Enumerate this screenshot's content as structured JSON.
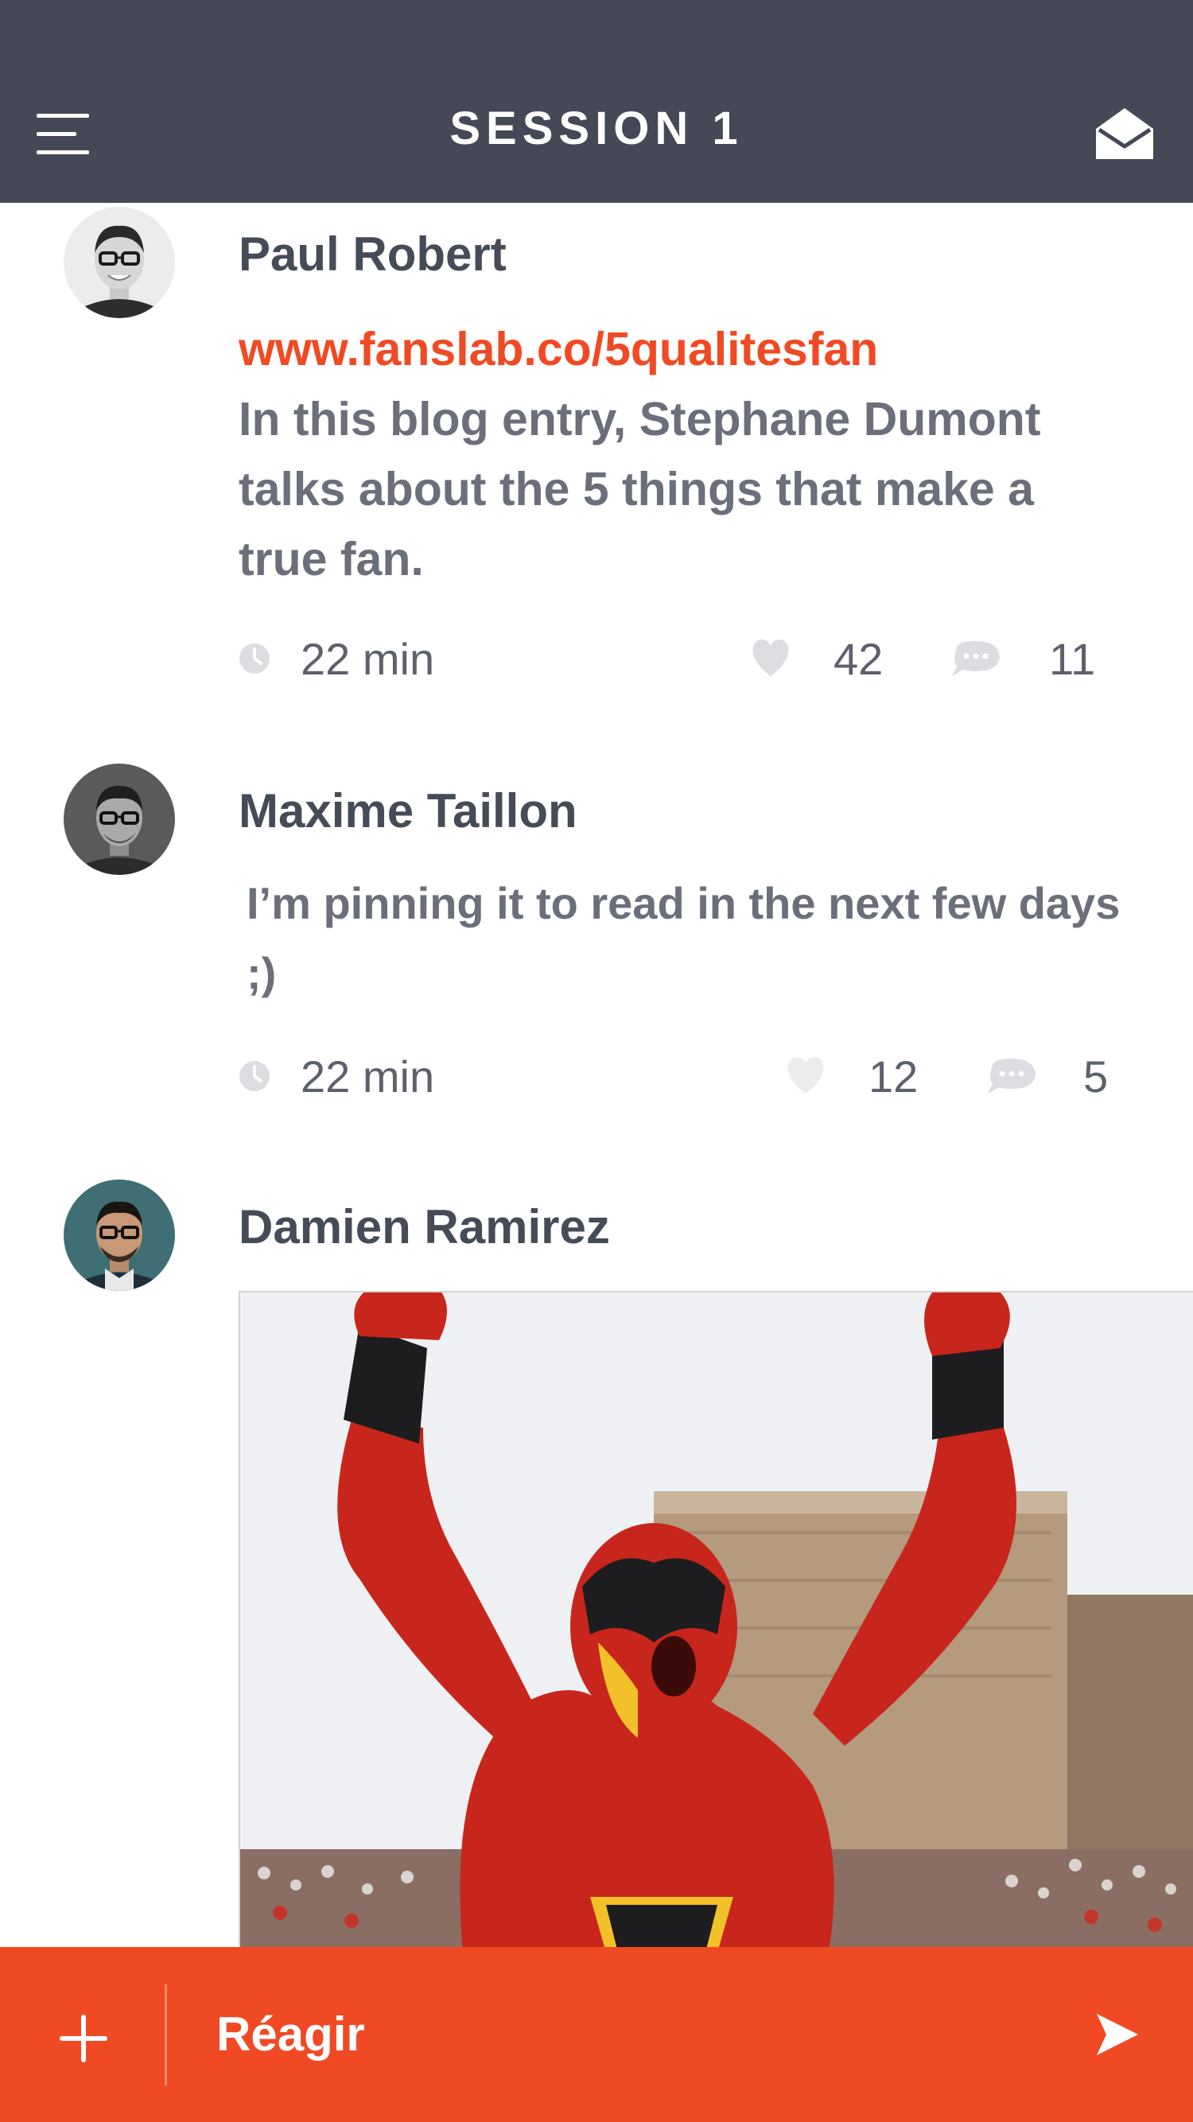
{
  "header": {
    "title": "SESSION 1",
    "background": "#454957"
  },
  "posts": [
    {
      "author": "Paul Robert",
      "link": "www.fanslab.co/5qualitesfan",
      "text": "In this blog entry, Stephane Dumont talks about the 5 things that make a true fan.",
      "time": "22 min",
      "likes": "42",
      "comments": "11"
    },
    {
      "author": "Maxime Taillon",
      "text": "I’m pinning it to read in the next few days ;)",
      "time": "22 min",
      "likes": "12",
      "comments": "5"
    },
    {
      "author": "Damien Ramirez"
    }
  ],
  "composer": {
    "placeholder": "Réagir",
    "background": "#f04a24"
  },
  "icons": {
    "menu": "menu-icon",
    "mail": "envelope-open-icon",
    "time": "clock-icon",
    "like": "heart-icon",
    "comment": "speech-bubble-icon",
    "add": "plus-icon",
    "send": "send-arrow-icon"
  },
  "colors": {
    "accent": "#f04a24",
    "header": "#454957",
    "text": "#464b58",
    "muted": "#6b6f7b",
    "icon": "#dcdde0"
  }
}
